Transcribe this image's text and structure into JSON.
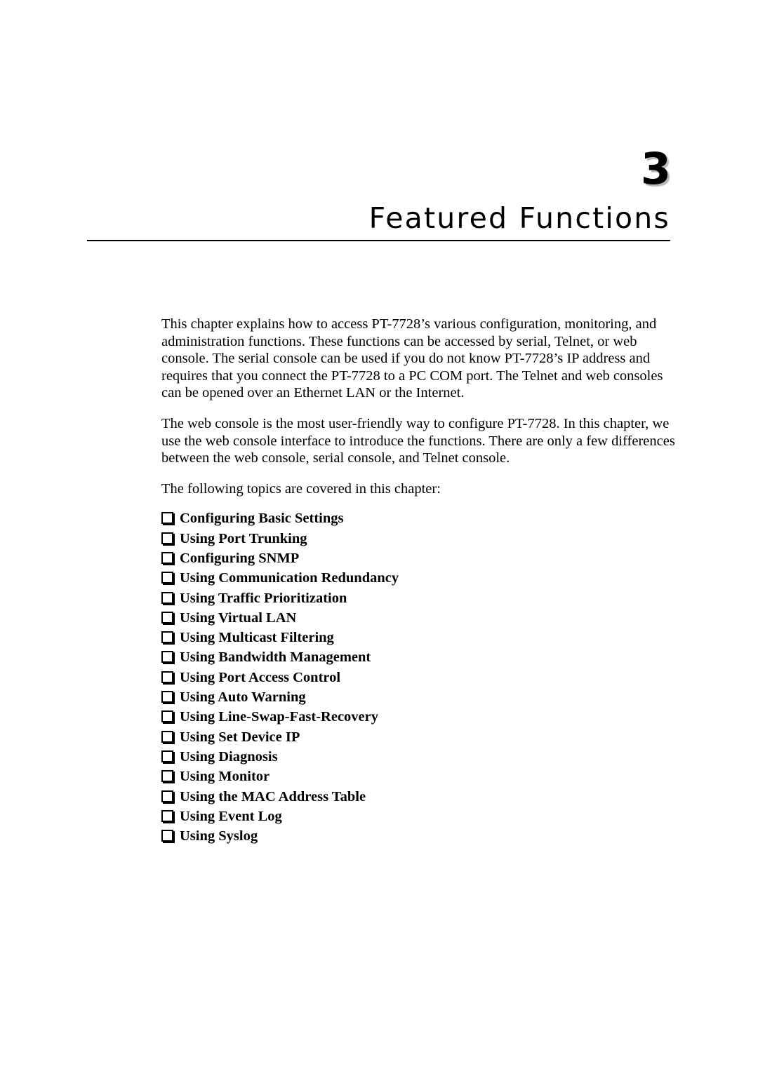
{
  "document": {
    "chapter_number": "3",
    "chapter_title": "Featured Functions"
  },
  "body": {
    "paragraph_1": "This chapter explains how to access PT-7728’s various configuration, monitoring, and administration functions. These functions can be accessed by serial, Telnet, or web console. The serial console can be used if you do not know PT-7728’s IP address and requires that you connect the PT-7728 to a PC COM port. The Telnet and web consoles can be opened over an Ethernet LAN or the Internet.",
    "paragraph_2": "The web console is the most user-friendly way to configure PT-7728. In this chapter, we use the web console interface to introduce the functions. There are only a few differences between the web console, serial console, and Telnet console.",
    "paragraph_3": "The following topics are covered in this chapter:"
  },
  "topics": {
    "bullet_glyph": "hollow-square",
    "items": [
      {
        "label": "Configuring Basic Settings"
      },
      {
        "label": "Using Port Trunking"
      },
      {
        "label": "Configuring SNMP"
      },
      {
        "label": "Using Communication Redundancy"
      },
      {
        "label": "Using Traffic Prioritization"
      },
      {
        "label": "Using Virtual LAN"
      },
      {
        "label": "Using Multicast Filtering"
      },
      {
        "label": "Using Bandwidth Management"
      },
      {
        "label": "Using Port Access Control"
      },
      {
        "label": "Using Auto Warning"
      },
      {
        "label": "Using Line-Swap-Fast-Recovery"
      },
      {
        "label": "Using Set Device IP"
      },
      {
        "label": "Using Diagnosis"
      },
      {
        "label": "Using Monitor"
      },
      {
        "label": "Using the MAC Address Table"
      },
      {
        "label": "Using Event Log"
      },
      {
        "label": "Using Syslog"
      }
    ]
  },
  "colors": {
    "page_background": "#ffffff",
    "text": "#000000",
    "rule": "#000000",
    "number_shadow": "#b9b9b9"
  }
}
